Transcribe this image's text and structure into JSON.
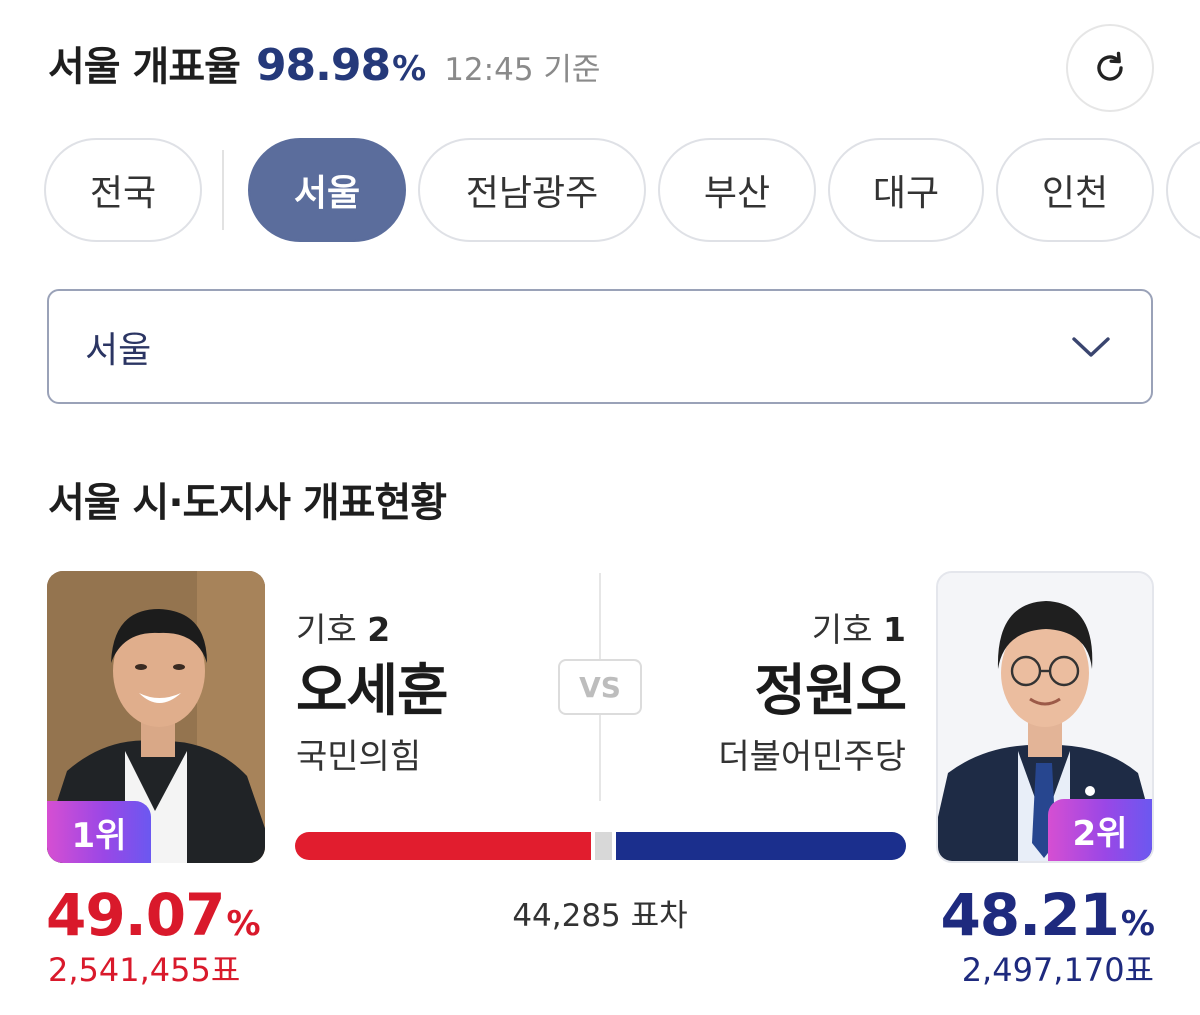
{
  "header": {
    "title": "서울 개표율",
    "rate": "98.98",
    "rate_unit": "%",
    "time": "12:45 기준"
  },
  "icons": {
    "refresh": "refresh-icon",
    "dropdown": "chevron-down-icon"
  },
  "regions": [
    "전국",
    "서울",
    "전남광주",
    "부산",
    "대구",
    "인천"
  ],
  "selected_region": "서울",
  "select": {
    "value": "서울"
  },
  "section_title": "서울 시·도지사 개표현황",
  "vs_label": "VS",
  "candidates": {
    "left": {
      "number_label": "기호",
      "number": "2",
      "name": "오세훈",
      "party": "국민의힘",
      "rank": "1위",
      "percent": "49.07",
      "percent_unit": "%",
      "votes": "2,541,455표",
      "share": 49.07
    },
    "right": {
      "number_label": "기호",
      "number": "1",
      "name": "정원오",
      "party": "더불어민주당",
      "rank": "2위",
      "percent": "48.21",
      "percent_unit": "%",
      "votes": "2,497,170표",
      "share": 48.21
    }
  },
  "vote_diff": "44,285 표차",
  "colors": {
    "accent": "#25397a",
    "chip_active": "#5b6d9c",
    "left_party": "#e11d2e",
    "right_party": "#1b2f8d",
    "rank_badge": "#9a47e6"
  }
}
